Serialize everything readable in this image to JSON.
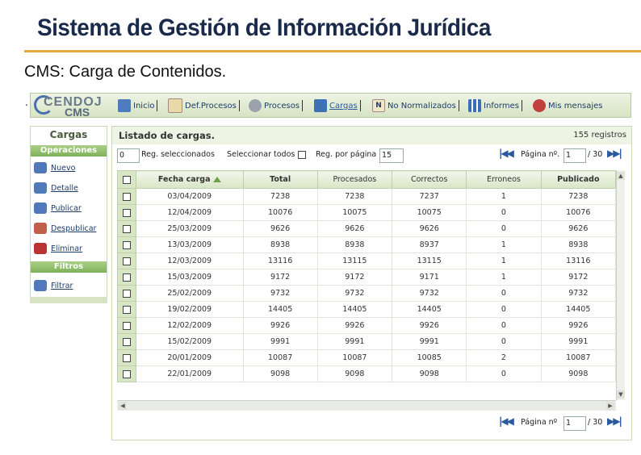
{
  "slide": {
    "title": "Sistema de Gestión de Información Jurídica",
    "subtitle": "CMS: Carga de Contenidos.",
    "bullet": "."
  },
  "logo": {
    "line1": "CENDOJ",
    "line2": "CMS"
  },
  "nav": [
    {
      "label": "Inicio",
      "icon": "home-icon"
    },
    {
      "label": "Def.Procesos",
      "icon": "document-icon"
    },
    {
      "label": "Procesos",
      "icon": "gear-icon"
    },
    {
      "label": "Cargas",
      "icon": "upload-icon"
    },
    {
      "label": "No Normalizados",
      "icon": "n-document-icon"
    },
    {
      "label": "Informes",
      "icon": "bar-chart-icon"
    },
    {
      "label": "Mis mensajes",
      "icon": "messages-icon"
    }
  ],
  "sidebar": {
    "title": "Cargas",
    "operations_header": "Operaciones",
    "operations": [
      {
        "label": "Nuevo",
        "icon": "new-icon"
      },
      {
        "label": "Detalle",
        "icon": "detail-icon"
      },
      {
        "label": "Publicar",
        "icon": "publish-icon"
      },
      {
        "label": "Despublicar",
        "icon": "unpublish-icon"
      },
      {
        "label": "Eliminar",
        "icon": "delete-icon"
      }
    ],
    "filters_header": "Filtros",
    "filters": [
      {
        "label": "Filtrar",
        "icon": "filter-icon"
      }
    ]
  },
  "panel": {
    "title": "Listado de cargas.",
    "records": "155 registros",
    "selected_count": "0",
    "selected_label": "Reg. seleccionados",
    "select_all_label": "Seleccionar todos",
    "per_page_label": "Reg. por página",
    "per_page_value": "15",
    "page_label": "Página nº.",
    "page_value": "1",
    "page_total": "/ 30",
    "bottom_page_label": "Página nº",
    "bottom_page_value": "1",
    "bottom_page_total": "/ 30"
  },
  "table": {
    "columns": [
      "Fecha carga",
      "Total",
      "Procesados",
      "Correctos",
      "Erroneos",
      "Publicado"
    ],
    "rows": [
      [
        "03/04/2009",
        "7238",
        "7238",
        "7237",
        "1",
        "7238"
      ],
      [
        "12/04/2009",
        "10076",
        "10075",
        "10075",
        "0",
        "10076"
      ],
      [
        "25/03/2009",
        "9626",
        "9626",
        "9626",
        "0",
        "9626"
      ],
      [
        "13/03/2009",
        "8938",
        "8938",
        "8937",
        "1",
        "8938"
      ],
      [
        "12/03/2009",
        "13116",
        "13115",
        "13115",
        "1",
        "13116"
      ],
      [
        "15/03/2009",
        "9172",
        "9172",
        "9171",
        "1",
        "9172"
      ],
      [
        "25/02/2009",
        "9732",
        "9732",
        "9732",
        "0",
        "9732"
      ],
      [
        "19/02/2009",
        "14405",
        "14405",
        "14405",
        "0",
        "14405"
      ],
      [
        "12/02/2009",
        "9926",
        "9926",
        "9926",
        "0",
        "9926"
      ],
      [
        "15/02/2009",
        "9991",
        "9991",
        "9991",
        "0",
        "9991"
      ],
      [
        "20/01/2009",
        "10087",
        "10087",
        "10085",
        "2",
        "10087"
      ],
      [
        "22/01/2009",
        "9098",
        "9098",
        "9098",
        "0",
        "9098"
      ]
    ]
  }
}
